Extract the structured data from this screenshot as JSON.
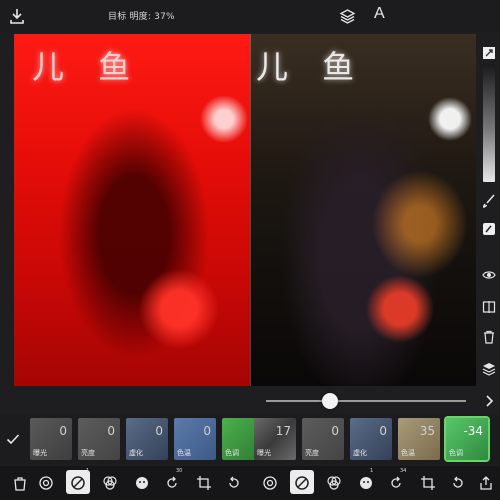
{
  "topbar": {
    "status_text": "目标 明度: 37%",
    "text_tool_label": "A"
  },
  "image": {
    "left_sign": "儿 鱼",
    "right_sign": "儿 鱼"
  },
  "compare_slider": {
    "position_fraction": 0.32
  },
  "presets": [
    {
      "label": "曝光",
      "value": "0"
    },
    {
      "label": "亮度",
      "value": "0"
    },
    {
      "label": "虚化",
      "value": "0"
    },
    {
      "label": "色温",
      "value": "0"
    },
    {
      "label": "色调",
      "value": ""
    },
    {
      "label": "曝光",
      "value": "17"
    },
    {
      "label": "亮度",
      "value": "0"
    },
    {
      "label": "虚化",
      "value": "0"
    },
    {
      "label": "色温",
      "value": "35"
    },
    {
      "label": "色调",
      "value": "-34"
    }
  ],
  "toolbar": {
    "badges": [
      "1",
      "30",
      "1",
      "34"
    ]
  },
  "colors": {
    "active_preset": "#6bd36a",
    "background": "#1e1e20"
  }
}
